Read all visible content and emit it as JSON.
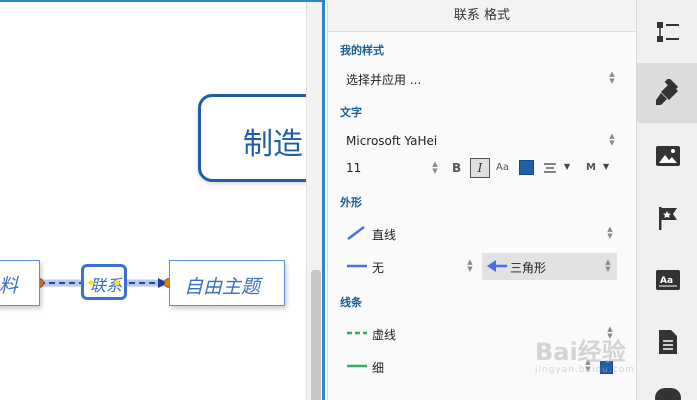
{
  "canvas": {
    "main_topic": "制造",
    "left_topic": "料",
    "connector_label": "联系",
    "right_topic": "自由主题"
  },
  "panel": {
    "title": "联系 格式",
    "my_style": {
      "heading": "我的样式",
      "value": "选择并应用 ..."
    },
    "text": {
      "heading": "文字",
      "font": "Microsoft YaHei",
      "size": "11",
      "bold": "B",
      "italic": "I",
      "case": "Aa",
      "color": "#1f5ea8",
      "more": "M"
    },
    "shape": {
      "heading": "外形",
      "line_type": "直线",
      "start_arrow": "无",
      "end_arrow": "三角形"
    },
    "line": {
      "heading": "线条",
      "pattern": "虚线",
      "weight": "细",
      "color": "#1f5ea8"
    }
  },
  "sidebar": {
    "items": [
      {
        "icon": "outline-icon"
      },
      {
        "icon": "brush-icon"
      },
      {
        "icon": "image-icon"
      },
      {
        "icon": "flag-icon"
      },
      {
        "icon": "text-box-icon"
      },
      {
        "icon": "document-icon"
      }
    ]
  },
  "watermark": {
    "brand": "Bai经验",
    "url": "jingyan.baidu.com"
  }
}
